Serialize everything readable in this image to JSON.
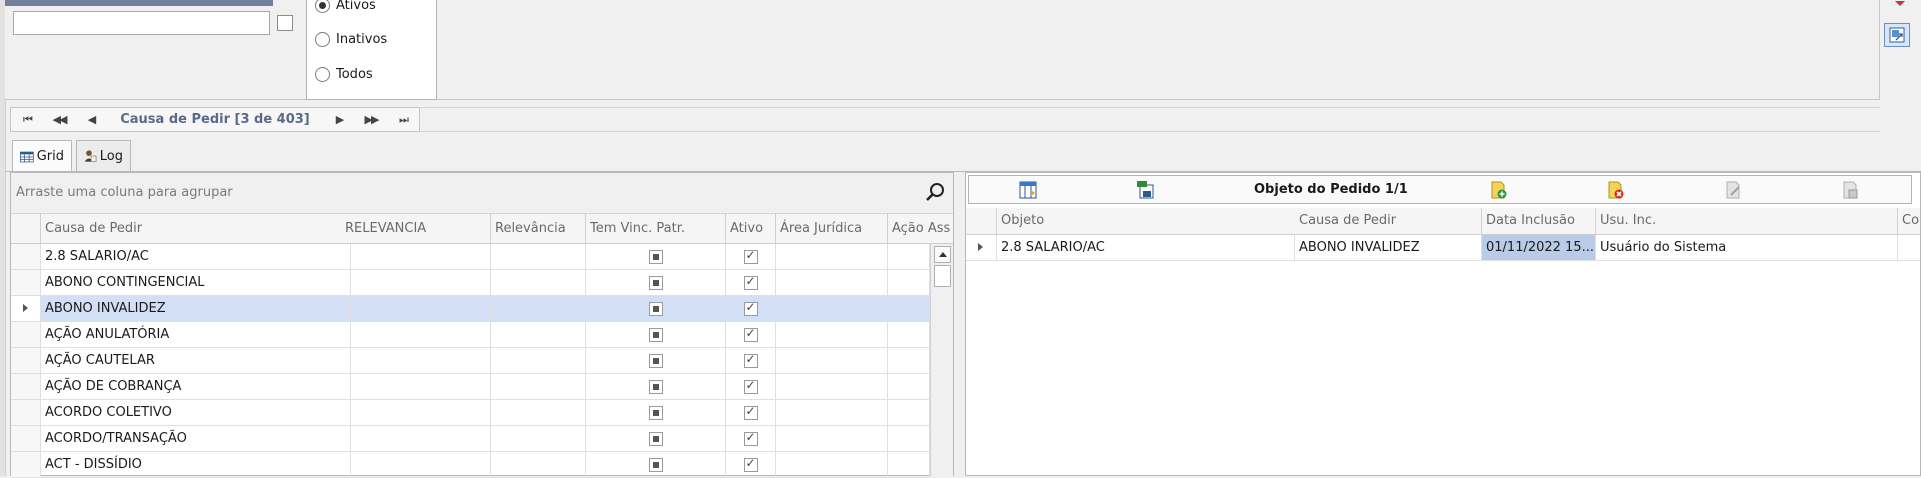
{
  "filter": {
    "search_value": "",
    "status_options": [
      {
        "label": "Ativos",
        "selected": true
      },
      {
        "label": "Inativos",
        "selected": false
      },
      {
        "label": "Todos",
        "selected": false
      }
    ]
  },
  "navigator": {
    "first": "⏮",
    "prev_page": "◀◀",
    "prev": "◀",
    "title": "Causa de Pedir [3 de 403]",
    "next": "▶",
    "next_page": "▶▶",
    "last": "⏭"
  },
  "tabs": [
    {
      "label": "Grid",
      "icon": "grid-icon",
      "active": true
    },
    {
      "label": "Log",
      "icon": "log-user-icon",
      "active": false
    }
  ],
  "left_grid": {
    "group_hint": "Arraste uma coluna para agrupar",
    "columns": [
      "Causa de Pedir",
      "RELEVANCIA",
      "Relevância",
      "Tem Vinc. Patr.",
      "Ativo",
      "Área Jurídica",
      "Ação Ass"
    ],
    "rows": [
      {
        "causa": "2.8 SALARIO/AC",
        "selected": false
      },
      {
        "causa": "ABONO CONTINGENCIAL",
        "selected": false
      },
      {
        "causa": "ABONO INVALIDEZ",
        "selected": true
      },
      {
        "causa": "AÇÃO ANULATÓRIA",
        "selected": false
      },
      {
        "causa": "AÇÃO CAUTELAR",
        "selected": false
      },
      {
        "causa": "AÇÃO DE COBRANÇA",
        "selected": false
      },
      {
        "causa": "ACORDO COLETIVO",
        "selected": false
      },
      {
        "causa": "ACORDO/TRANSAÇÃO",
        "selected": false
      },
      {
        "causa": "ACT - DISSÍDIO",
        "selected": false
      }
    ]
  },
  "right_grid": {
    "title": "Objeto do Pedido 1/1",
    "columns": [
      "Objeto",
      "Causa de Pedir",
      "Data Inclusão",
      "Usu. Inc.",
      "Co"
    ],
    "rows": [
      {
        "objeto": "2.8 SALARIO/AC",
        "causa": "ABONO INVALIDEZ",
        "data": "01/11/2022 15...",
        "usuario": "Usuário do Sistema"
      }
    ]
  },
  "colors": {
    "selected_row": "#d3dff4",
    "focused_cell": "#b9cbe6",
    "navigator_title": "#5a6a8a"
  }
}
